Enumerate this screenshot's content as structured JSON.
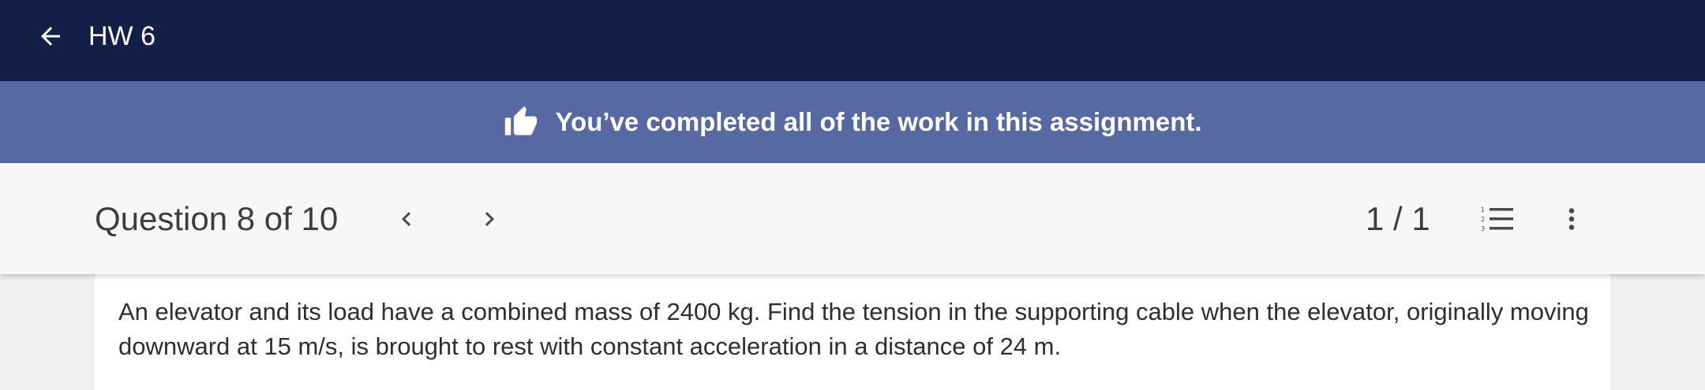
{
  "header": {
    "title": "HW 6",
    "back_icon": "arrow-left-icon"
  },
  "banner": {
    "icon": "thumbs-up-icon",
    "message": "You’ve completed all of the work in this assignment."
  },
  "question_bar": {
    "title": "Question 8 of 10",
    "prev_icon": "chevron-left-icon",
    "next_icon": "chevron-right-icon",
    "pager": "1 / 1",
    "list_icon": "numbered-list-icon",
    "more_icon": "more-vertical-icon"
  },
  "question": {
    "text": "An elevator and its load have a combined mass of 2400 kg. Find the tension in the supporting cable when the elevator, originally moving downward at 15 m/s, is brought to rest with constant acceleration in a distance of 24 m."
  },
  "colors": {
    "topbar": "#141f47",
    "banner": "#5769a2",
    "question_bar": "#f7f7f7"
  }
}
